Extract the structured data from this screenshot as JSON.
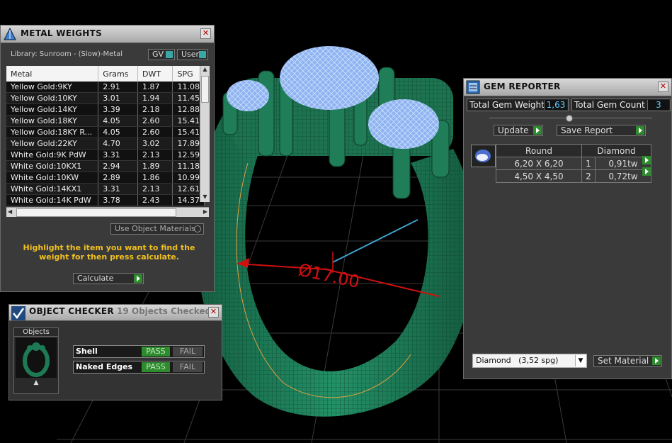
{
  "viewport": {
    "dimension_label": "Ø17.00"
  },
  "metal_weights": {
    "title": "METAL WEIGHTS",
    "library": "Library: Sunroom - (Slow)-Metal",
    "toggle_gv": "GV",
    "toggle_user": "User",
    "columns": [
      "Metal",
      "Grams",
      "DWT",
      "SPG"
    ],
    "rows": [
      [
        "Yellow Gold:9KY",
        "2.91",
        "1.87",
        "11.08"
      ],
      [
        "Yellow Gold:10KY",
        "3.01",
        "1.94",
        "11.45"
      ],
      [
        "Yellow Gold:14KY",
        "3.39",
        "2.18",
        "12.88"
      ],
      [
        "Yellow Gold:18KY",
        "4.05",
        "2.60",
        "15.41"
      ],
      [
        "Yellow Gold:18KY R...",
        "4.05",
        "2.60",
        "15.41"
      ],
      [
        "Yellow Gold:22KY",
        "4.70",
        "3.02",
        "17.89"
      ],
      [
        "White Gold:9K PdW",
        "3.31",
        "2.13",
        "12.59"
      ],
      [
        "White Gold:10KX1",
        "2.94",
        "1.89",
        "11.18"
      ],
      [
        "White Gold:10KW",
        "2.89",
        "1.86",
        "10.99"
      ],
      [
        "White Gold:14KX1",
        "3.31",
        "2.13",
        "12.61"
      ],
      [
        "White Gold:14K PdW",
        "3.78",
        "2.43",
        "14.37"
      ]
    ],
    "use_object_materials": "Use Object Materials",
    "hint": "Highlight the item you want to find the weight for then press calculate.",
    "calculate": "Calculate"
  },
  "object_checker": {
    "title": "OBJECT CHECKER",
    "status": "19  Objects Checked",
    "objects_label": "Objects",
    "checks": [
      {
        "name": "Shell",
        "pass": "PASS",
        "fail": "FAIL"
      },
      {
        "name": "Naked Edges",
        "pass": "PASS",
        "fail": "FAIL"
      }
    ]
  },
  "gem_reporter": {
    "title": "GEM REPORTER",
    "total_weight_label": "Total Gem Weight",
    "total_weight": "1,63",
    "total_count_label": "Total Gem Count",
    "total_count": "3",
    "update": "Update",
    "save_report": "Save Report",
    "shape": "Round",
    "type": "Diamond",
    "gems": [
      {
        "size": "6,20 X 6,20",
        "count": "1",
        "weight": "0,91tw"
      },
      {
        "size": "4,50 X 4,50",
        "count": "2",
        "weight": "0,72tw"
      }
    ],
    "material_select": "Diamond   (3,52 spg)",
    "set_material": "Set Material"
  },
  "colors": {
    "ring": "#1e7a55",
    "gem": "#8fb4f0",
    "pass": "#2e8b2e",
    "hint": "#f0c020",
    "dimension": "#d01010"
  }
}
